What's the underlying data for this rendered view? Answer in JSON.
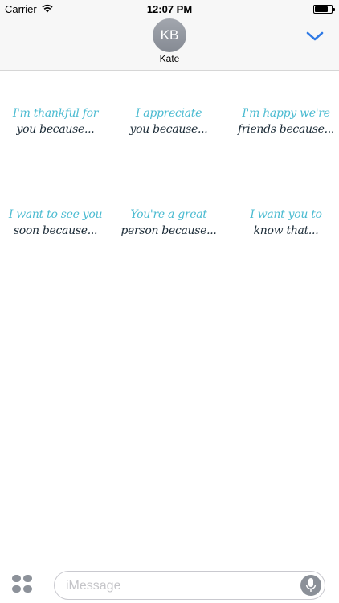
{
  "status_bar": {
    "carrier": "Carrier",
    "time": "12:07 PM",
    "battery_level": 0.8
  },
  "header": {
    "avatar_initials": "KB",
    "contact_name": "Kate",
    "collapse_icon": "chevron-down-icon",
    "accent_color": "#2f7ae5"
  },
  "stickers": [
    {
      "line1": "I'm thankful for",
      "line2": "you because..."
    },
    {
      "line1": "I appreciate",
      "line2": "you because..."
    },
    {
      "line1": "I'm happy we're",
      "line2": "friends because..."
    },
    {
      "line1": "I want to see you",
      "line2": "soon because..."
    },
    {
      "line1": "You're a great",
      "line2": "person because..."
    },
    {
      "line1": "I want you to",
      "line2": "know that..."
    }
  ],
  "sticker_colors": {
    "script": "#4bbbd1",
    "body": "#1a2a36"
  },
  "input_bar": {
    "apps_icon": "app-drawer-icon",
    "placeholder": "iMessage",
    "mic_icon": "microphone-icon"
  }
}
